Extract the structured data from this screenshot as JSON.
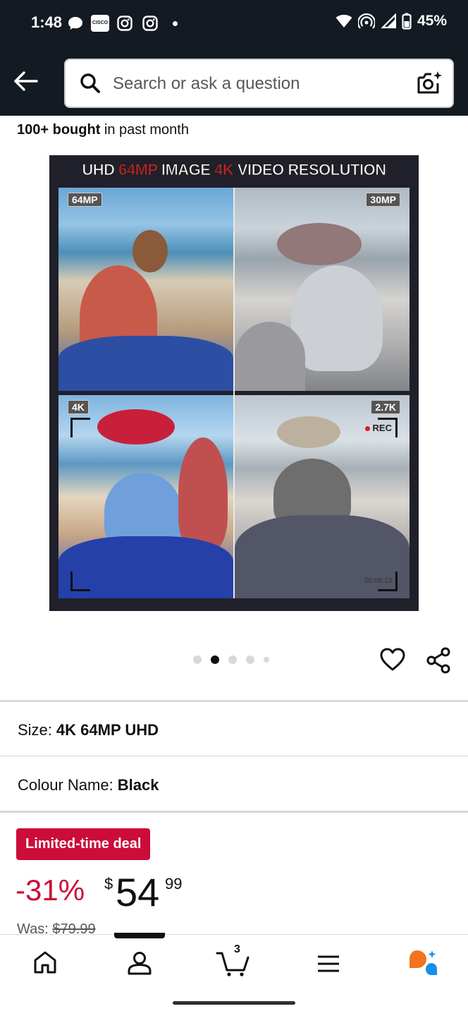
{
  "status_bar": {
    "time": "1:48",
    "notification_icons": [
      "chat-icon",
      "cisco-icon",
      "instagram-icon",
      "instagram-icon",
      "dot-icon"
    ],
    "cisco_label": "CISCO",
    "battery": "45%"
  },
  "header": {
    "search_placeholder": "Search or ask a question"
  },
  "product": {
    "bought_bold": "100+ bought",
    "bought_rest": " in past month",
    "image": {
      "title_part1": "UHD ",
      "title_part2": "64MP",
      "title_part3": " IMAGE ",
      "title_part4": "4K",
      "title_part5": " VIDEO RESOLUTION",
      "tag_top_left": "64MP",
      "tag_top_right": "30MP",
      "tag_bottom_left": "4K",
      "tag_bottom_right": "2.7K",
      "rec_label": "REC",
      "timer": "00:06:13"
    },
    "carousel": {
      "count": 5,
      "active_index": 1
    }
  },
  "variations": {
    "size_label": "Size:",
    "size_value": "4K 64MP UHD",
    "colour_label": "Colour Name:",
    "colour_value": "Black"
  },
  "pricing": {
    "deal_badge": "Limited-time deal",
    "discount": "-31%",
    "currency": "$",
    "price_whole": "54",
    "price_fraction": "99",
    "was_label": "Was:",
    "was_price": "$79.99"
  },
  "bottom_nav": {
    "items": [
      "home-icon",
      "account-icon",
      "cart-icon",
      "menu-icon",
      "rufus-icon"
    ],
    "cart_count": "3",
    "active_index": 1
  },
  "colors": {
    "header_bg": "#131a22",
    "deal_red": "#cc0c39",
    "text": "#0f1111",
    "muted": "#565959"
  }
}
